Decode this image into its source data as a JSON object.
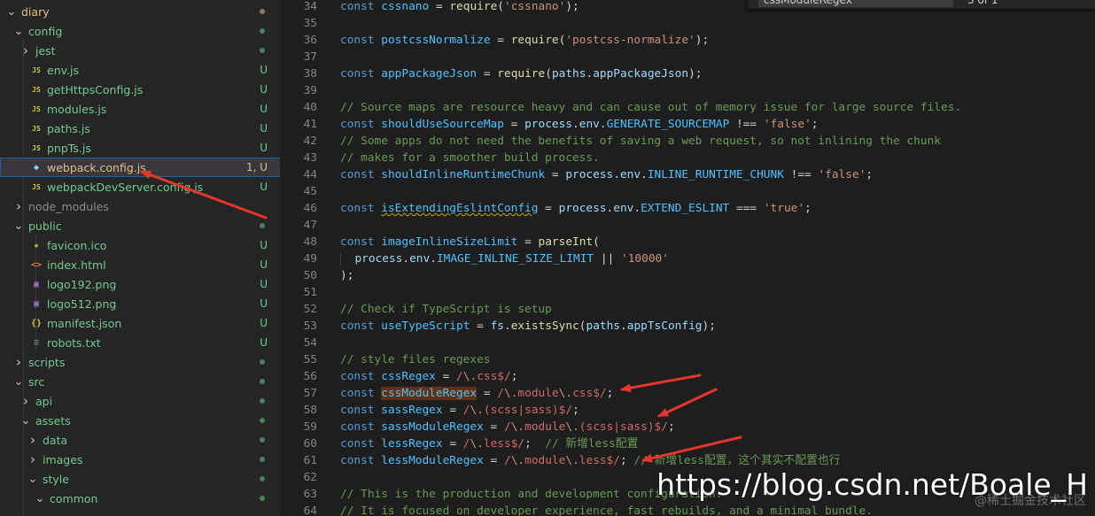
{
  "explorer": {
    "items": [
      {
        "label": "diary",
        "depth": 0,
        "kind": "folder-open",
        "status": "dot-mod"
      },
      {
        "label": "config",
        "depth": 1,
        "kind": "folder-open",
        "status": "dot"
      },
      {
        "label": "jest",
        "depth": 2,
        "kind": "folder-closed",
        "status": "dot"
      },
      {
        "label": "env.js",
        "depth": 2,
        "kind": "js",
        "status": "U"
      },
      {
        "label": "getHttpsConfig.js",
        "depth": 2,
        "kind": "js",
        "status": "U"
      },
      {
        "label": "modules.js",
        "depth": 2,
        "kind": "js",
        "status": "U"
      },
      {
        "label": "paths.js",
        "depth": 2,
        "kind": "js",
        "status": "U"
      },
      {
        "label": "pnpTs.js",
        "depth": 2,
        "kind": "js",
        "status": "U"
      },
      {
        "label": "webpack.config.js",
        "depth": 2,
        "kind": "webpack",
        "status": "1, U",
        "selected": true
      },
      {
        "label": "webpackDevServer.config.js",
        "depth": 2,
        "kind": "js",
        "status": "U"
      },
      {
        "label": "node_modules",
        "depth": 1,
        "kind": "folder-closed-ignored",
        "status": ""
      },
      {
        "label": "public",
        "depth": 1,
        "kind": "folder-open",
        "status": "dot"
      },
      {
        "label": "favicon.ico",
        "depth": 2,
        "kind": "star",
        "status": "U"
      },
      {
        "label": "index.html",
        "depth": 2,
        "kind": "html",
        "status": "U"
      },
      {
        "label": "logo192.png",
        "depth": 2,
        "kind": "image",
        "status": "U"
      },
      {
        "label": "logo512.png",
        "depth": 2,
        "kind": "image",
        "status": "U"
      },
      {
        "label": "manifest.json",
        "depth": 2,
        "kind": "json",
        "status": "U"
      },
      {
        "label": "robots.txt",
        "depth": 2,
        "kind": "txt",
        "status": "U"
      },
      {
        "label": "scripts",
        "depth": 1,
        "kind": "folder-closed",
        "status": "dot"
      },
      {
        "label": "src",
        "depth": 1,
        "kind": "folder-open",
        "status": "dot"
      },
      {
        "label": "api",
        "depth": 2,
        "kind": "folder-closed",
        "status": "dot"
      },
      {
        "label": "assets",
        "depth": 2,
        "kind": "folder-open",
        "status": "dot"
      },
      {
        "label": "data",
        "depth": 3,
        "kind": "folder-closed",
        "status": "dot"
      },
      {
        "label": "images",
        "depth": 3,
        "kind": "folder-closed",
        "status": "dot"
      },
      {
        "label": "style",
        "depth": 3,
        "kind": "folder-open",
        "status": "dot"
      },
      {
        "label": "common",
        "depth": 4,
        "kind": "folder-open",
        "status": "dot"
      }
    ]
  },
  "editor": {
    "find_query": "cssModuleRegex",
    "find_count": "3 of 1",
    "lines": [
      {
        "n": "34",
        "html": "<span class='k'>const</span> <span class='c'>cssnano</span> <span class='o'>=</span> <span class='f'>require</span>(<span class='s'>'cssnano'</span>);"
      },
      {
        "n": "35",
        "html": ""
      },
      {
        "n": "36",
        "html": "<span class='k'>const</span> <span class='c'>postcssNormalize</span> <span class='o'>=</span> <span class='f'>require</span>(<span class='s'>'postcss-normalize'</span>);"
      },
      {
        "n": "37",
        "html": ""
      },
      {
        "n": "38",
        "html": "<span class='k'>const</span> <span class='c'>appPackageJson</span> <span class='o'>=</span> <span class='f'>require</span>(<span class='v'>paths</span>.<span class='v'>appPackageJson</span>);"
      },
      {
        "n": "39",
        "html": ""
      },
      {
        "n": "40",
        "html": "<span class='cm'>// Source maps are resource heavy and can cause out of memory issue for large source files.</span>"
      },
      {
        "n": "41",
        "html": "<span class='k'>const</span> <span class='c'>shouldUseSourceMap</span> <span class='o'>=</span> <span class='v'>process</span>.<span class='v'>env</span>.<span class='c'>GENERATE_SOURCEMAP</span> <span class='o'>!==</span> <span class='s'>'false'</span>;"
      },
      {
        "n": "42",
        "html": "<span class='cm'>// Some apps do not need the benefits of saving a web request, so not inlining the chunk</span>"
      },
      {
        "n": "43",
        "html": "<span class='cm'>// makes for a smoother build process.</span>"
      },
      {
        "n": "44",
        "html": "<span class='k'>const</span> <span class='c'>shouldInlineRuntimeChunk</span> <span class='o'>=</span> <span class='v'>process</span>.<span class='v'>env</span>.<span class='c'>INLINE_RUNTIME_CHUNK</span> <span class='o'>!==</span> <span class='s'>'false'</span>;"
      },
      {
        "n": "45",
        "html": ""
      },
      {
        "n": "46",
        "html": "<span class='k'>const</span> <span class='c squig'>isExtendingEslintConfig</span> <span class='o'>=</span> <span class='v'>process</span>.<span class='v'>env</span>.<span class='c'>EXTEND_ESLINT</span> <span class='o'>===</span> <span class='s'>'true'</span>;"
      },
      {
        "n": "47",
        "html": ""
      },
      {
        "n": "48",
        "html": "<span class='k'>const</span> <span class='c'>imageInlineSizeLimit</span> <span class='o'>=</span> <span class='f'>parseInt</span>("
      },
      {
        "n": "49",
        "html": "<span class='bracket-guide'> </span> <span class='v'>process</span>.<span class='v'>env</span>.<span class='c'>IMAGE_INLINE_SIZE_LIMIT</span> <span class='o'>||</span> <span class='s'>'10000'</span>"
      },
      {
        "n": "50",
        "html": ");"
      },
      {
        "n": "51",
        "html": ""
      },
      {
        "n": "52",
        "html": "<span class='cm'>// Check if TypeScript is setup</span>"
      },
      {
        "n": "53",
        "html": "<span class='k'>const</span> <span class='c'>useTypeScript</span> <span class='o'>=</span> <span class='v'>fs</span>.<span class='f'>existsSync</span>(<span class='v'>paths</span>.<span class='v'>appTsConfig</span>);"
      },
      {
        "n": "54",
        "html": ""
      },
      {
        "n": "55",
        "html": "<span class='cm'>// style files regexes</span>"
      },
      {
        "n": "56",
        "html": "<span class='k'>const</span> <span class='c'>cssRegex</span> <span class='o'>=</span> <span class='r'>/</span><span class='re'>\\.</span><span class='r'>css$/</span>;"
      },
      {
        "n": "57",
        "html": "<span class='k'>const</span> <span class='c hl'>cssModuleRegex</span> <span class='o'>=</span> <span class='r'>/</span><span class='re'>\\.</span><span class='r'>module</span><span class='re'>\\.</span><span class='r'>css$/</span>;"
      },
      {
        "n": "58",
        "html": "<span class='k'>const</span> <span class='c'>sassRegex</span> <span class='o'>=</span> <span class='r'>/</span><span class='re'>\\.</span><span class='r'>(scss|sass)$/</span>;"
      },
      {
        "n": "59",
        "html": "<span class='k'>const</span> <span class='c'>sassModuleRegex</span> <span class='o'>=</span> <span class='r'>/</span><span class='re'>\\.</span><span class='r'>module</span><span class='re'>\\.</span><span class='r'>(scss|sass)$/</span>;"
      },
      {
        "n": "60",
        "html": "<span class='k'>const</span> <span class='c'>lessRegex</span> <span class='o'>=</span> <span class='r'>/</span><span class='re'>\\.</span><span class='r'>less$/</span>;  <span class='cm'>// 新增less配置</span>"
      },
      {
        "n": "61",
        "html": "<span class='k'>const</span> <span class='c'>lessModuleRegex</span> <span class='o'>=</span> <span class='r'>/</span><span class='re'>\\.</span><span class='r'>module</span><span class='re'>\\.</span><span class='r'>less$/</span>; <span class='cm'>// 新增less配置，这个其实不配置也行</span>"
      },
      {
        "n": "62",
        "html": ""
      },
      {
        "n": "63",
        "html": "<span class='cm'>// This is the production and development configuration.</span>"
      },
      {
        "n": "64",
        "html": "<span class='cm'>// It is focused on developer experience, fast rebuilds, and a minimal bundle.</span>"
      }
    ]
  },
  "watermark": {
    "url": "https://blog.csdn.net/Boale_H",
    "sub": "@稀土掘金技术社区"
  },
  "colors": {
    "arrow": "#e8352a"
  }
}
